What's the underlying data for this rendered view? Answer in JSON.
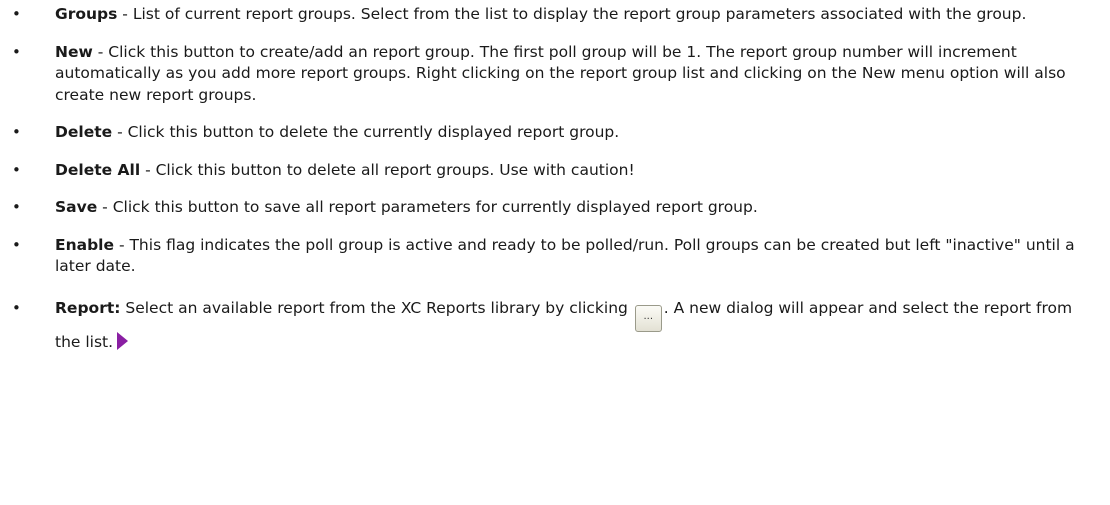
{
  "items": [
    {
      "term": "Groups",
      "separator": " - ",
      "text": "List of current report groups.  Select from the list to display the report group parameters associated with the group."
    },
    {
      "term": "New",
      "separator": " - ",
      "text": "Click this button to create/add an report group.  The first poll group will be 1.  The report group number will increment automatically as you add more report groups.  Right clicking on the report group list and clicking on the New menu option will also create new report groups."
    },
    {
      "term": "Delete",
      "separator": " - ",
      "text": "Click this button to delete the currently displayed report group."
    },
    {
      "term": "Delete All",
      "separator": " - ",
      "text": "Click this button to delete all report groups.  Use with caution!"
    },
    {
      "term": "Save",
      "separator": " - ",
      "text": "Click this button to save all report parameters for currently displayed report group."
    },
    {
      "term": "Enable",
      "separator": " - ",
      "text": "This flag indicates the poll group is active and ready to be polled/run.  Poll groups can be created but left \"inactive\" until a later date."
    }
  ],
  "report_item": {
    "term": "Report:",
    "text_before": " Select an available report from the XC Reports library by clicking ",
    "button_label": "...",
    "text_after": ".  A new dialog will appear and select the report from the list."
  },
  "bullet_glyph": "•",
  "colors": {
    "text": "#1a1a1a",
    "arrow_marker": "#8a1fa3"
  },
  "icons": {
    "ellipsis_button": "ellipsis-button-icon",
    "arrow_marker": "arrow-marker-icon"
  }
}
